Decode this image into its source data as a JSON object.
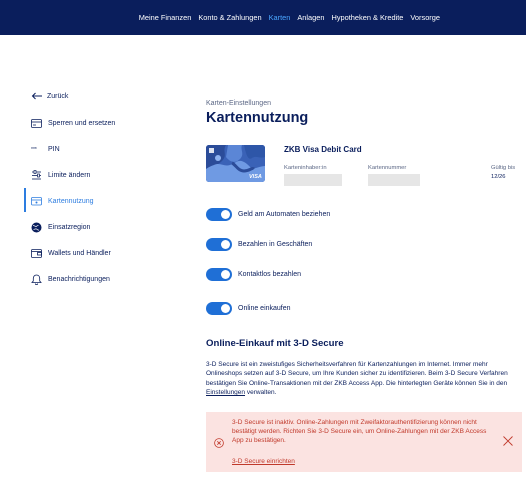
{
  "topnav": {
    "items": [
      {
        "label": "Meine Finanzen"
      },
      {
        "label": "Konto & Zahlungen"
      },
      {
        "label": "Karten",
        "active": true
      },
      {
        "label": "Anlagen"
      },
      {
        "label": "Hypotheken & Kredite"
      },
      {
        "label": "Vorsorge"
      }
    ]
  },
  "sidebar": {
    "back_label": "Zurück",
    "items": [
      {
        "label": "Sperren und ersetzen",
        "icon": "card-replace-icon"
      },
      {
        "label": "PIN",
        "icon": "pin-dots-icon"
      },
      {
        "label": "Limite ändern",
        "icon": "limit-sliders-icon"
      },
      {
        "label": "Kartennutzung",
        "icon": "card-usage-icon",
        "active": true
      },
      {
        "label": "Einsatzregion",
        "icon": "globe-icon"
      },
      {
        "label": "Wallets und Händler",
        "icon": "wallet-icon"
      },
      {
        "label": "Benachrichtigungen",
        "icon": "bell-icon"
      }
    ]
  },
  "main": {
    "breadcrumb": "Karten-Einstellungen",
    "title": "Kartennutzung",
    "card": {
      "name": "ZKB Visa Debit Card",
      "holder_label": "Karteninhaber:in",
      "number_label": "Kartennummer",
      "expiry_label": "Gültig bis",
      "expiry_value": "12/26",
      "brand": "VISA"
    },
    "toggles": [
      {
        "label": "Geld am Automaten beziehen",
        "on": true
      },
      {
        "label": "Bezahlen in Geschäften",
        "on": true
      },
      {
        "label": "Kontaktlos bezahlen",
        "on": true
      },
      {
        "label": "Online einkaufen",
        "on": true
      }
    ],
    "secure": {
      "heading": "Online-Einkauf mit 3-D Secure",
      "para_1": "3-D Secure ist ein zweistufiges Sicherheitsverfahren für Kartenzahlungen im Internet. Immer mehr Onlineshops setzen auf 3-D Secure, um Ihre Kunden sicher zu identifizieren. Beim 3-D Secure Verfahren bestätigen Sie Online-Transaktionen mit der ZKB Access App. Die hinterlegten Geräte können Sie in den ",
      "para_link": "Einstellungen",
      "para_2": " verwalten."
    },
    "alert": {
      "text": "3-D Secure ist inaktiv. Online-Zahlungen mit Zweifaktorauthentifizierung können nicht bestätigt werden. Richten Sie 3-D Secure ein, um Online-Zahlungen mit der ZKB Access App zu bestätigen.",
      "link": "3-D Secure einrichten"
    }
  },
  "colors": {
    "nav_bg": "#0a1e5c",
    "accent": "#2d7de0",
    "toggle_on": "#1f6fd6",
    "alert_bg": "#fbe3e1",
    "alert_text": "#c0392b"
  }
}
